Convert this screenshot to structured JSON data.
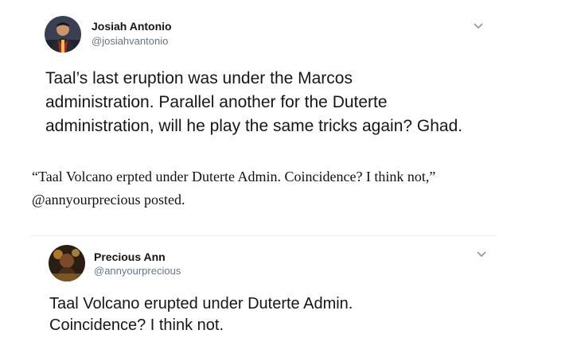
{
  "tweet1": {
    "name": "Josiah Antonio",
    "handle": "@josiahvantonio",
    "lines": [
      "Taal’s last eruption was under the Marcos",
      "administration. Parallel another for the Duterte",
      "administration, will he play the same tricks again? Ghad."
    ],
    "menu_icon": "chevron-down-icon"
  },
  "caption": {
    "lines": [
      "“Taal Volcano erpted under Duterte Admin. Coincidence? I think not,”",
      "@annyourprecious posted."
    ]
  },
  "tweet2": {
    "name": "Precious Ann",
    "handle": "@annyourprecious",
    "lines": [
      "Taal Volcano erupted under Duterte Admin.",
      "Coincidence? I think not."
    ],
    "menu_icon": "chevron-down-icon"
  }
}
